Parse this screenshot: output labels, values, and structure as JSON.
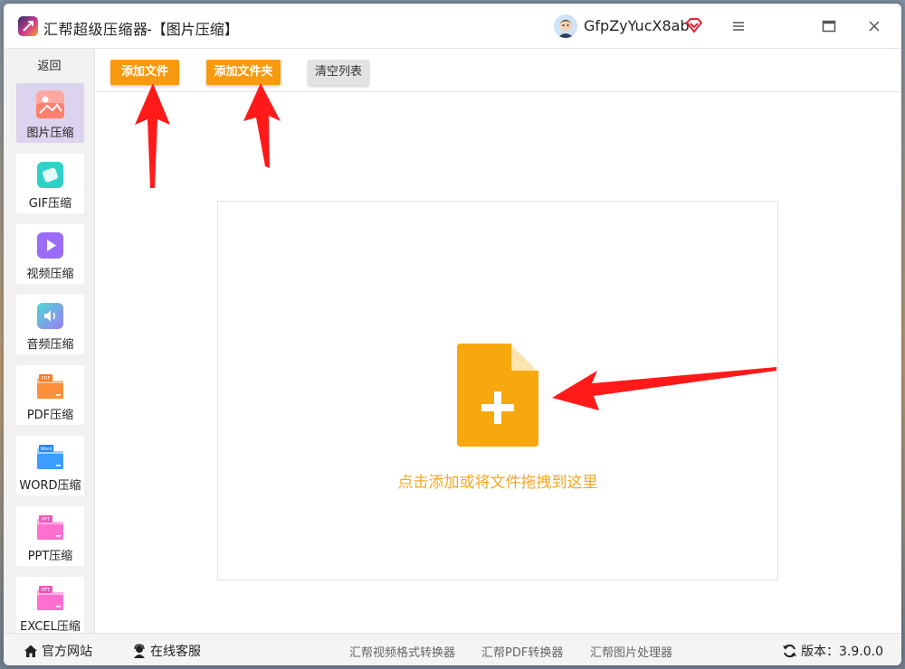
{
  "titlebar": {
    "app_name": "汇帮超级压缩器",
    "subtitle": "-【图片压缩】",
    "username": "GfpZyYucX8ab"
  },
  "sidebar": {
    "back_label": "返回",
    "items": [
      {
        "label": "图片压缩",
        "icon": "image-icon",
        "active": true
      },
      {
        "label": "GIF压缩",
        "icon": "gif-icon"
      },
      {
        "label": "视频压缩",
        "icon": "video-play-icon"
      },
      {
        "label": "音频压缩",
        "icon": "audio-speaker-icon"
      },
      {
        "label": "PDF压缩",
        "icon": "pdf-folder-icon",
        "badge": "PDF"
      },
      {
        "label": "WORD压缩",
        "icon": "word-folder-icon",
        "badge": "Word"
      },
      {
        "label": "PPT压缩",
        "icon": "ppt-folder-icon",
        "badge": "PPT"
      },
      {
        "label": "EXCEL压缩",
        "icon": "excel-folder-icon",
        "badge": "PPT"
      }
    ]
  },
  "toolbar": {
    "add_file": "添加文件",
    "add_folder": "添加文件夹",
    "clear_list": "清空列表"
  },
  "dropzone": {
    "hint": "点击添加或将文件拖拽到这里"
  },
  "statusbar": {
    "official_site": "官方网站",
    "online_service": "在线客服",
    "link_video": "汇帮视频格式转换器",
    "link_pdf": "汇帮PDF转换器",
    "link_image": "汇帮图片处理器",
    "version": "版本：3.9.0.0"
  },
  "colors": {
    "accent_orange": "#f79a0e",
    "hint_orange": "#f3a825",
    "arrow_red": "#ff1a1a",
    "active_nav": "#dcd3ee"
  }
}
